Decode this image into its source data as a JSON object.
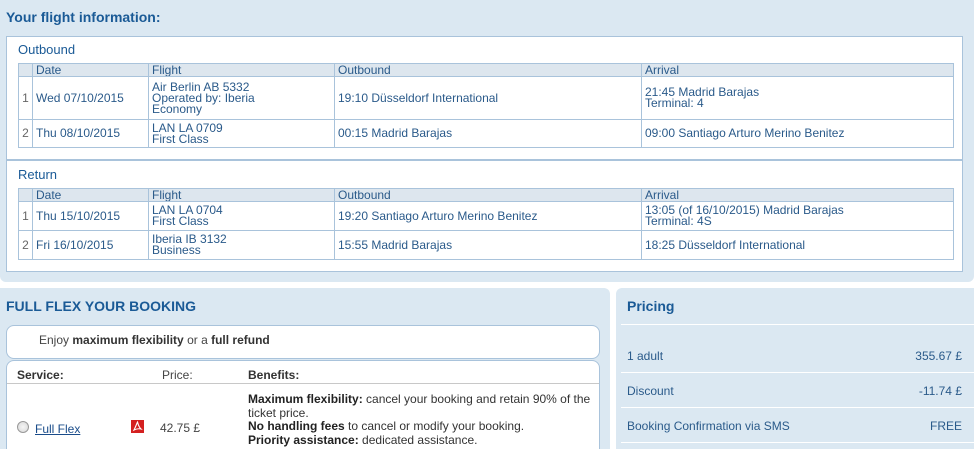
{
  "flight_info": {
    "title": "Your flight information:",
    "columns": [
      "Date",
      "Flight",
      "Outbound",
      "Arrival"
    ],
    "outbound": {
      "title": "Outbound",
      "rows": [
        {
          "n": "1",
          "date": "Wed 07/10/2015",
          "flight": [
            "Air Berlin AB 5332",
            "Operated by: Iberia",
            "Economy"
          ],
          "dep": "19:10 Düsseldorf International",
          "arr": [
            "21:45 Madrid Barajas",
            "Terminal: 4"
          ]
        },
        {
          "n": "2",
          "date": "Thu 08/10/2015",
          "flight": [
            "LAN LA 0709",
            "First Class"
          ],
          "dep": "00:15 Madrid Barajas",
          "arr": [
            "09:00 Santiago Arturo Merino Benitez"
          ]
        }
      ]
    },
    "return": {
      "title": "Return",
      "rows": [
        {
          "n": "1",
          "date": "Thu 15/10/2015",
          "flight": [
            "LAN LA 0704",
            "First Class"
          ],
          "dep": "19:20 Santiago Arturo Merino Benitez",
          "arr": [
            "13:05 (of 16/10/2015) Madrid Barajas",
            "Terminal: 4S"
          ]
        },
        {
          "n": "2",
          "date": "Fri 16/10/2015",
          "flight": [
            "Iberia IB 3132",
            "Business"
          ],
          "dep": "15:55 Madrid Barajas",
          "arr": [
            "18:25 Düsseldorf International"
          ]
        }
      ]
    }
  },
  "full_flex": {
    "title": "FULL FLEX YOUR BOOKING",
    "enjoy": {
      "a": "Enjoy ",
      "b": "maximum flexibility",
      "c": " or a ",
      "d": "full refund"
    },
    "headers": {
      "service": "Service:",
      "price": "Price:",
      "benefits": "Benefits:"
    },
    "service_name": "Full Flex",
    "icon": "pdf-icon",
    "price": "42.75 £",
    "benefits": [
      {
        "b": "Maximum flexibility:",
        "t": " cancel your booking and retain 90% of the ticket price."
      },
      {
        "b": "No handling fees",
        "t": " to cancel or modify your booking."
      },
      {
        "b": "Priority assistance:",
        "t": " dedicated assistance."
      }
    ]
  },
  "pricing": {
    "title": "Pricing",
    "rows": [
      {
        "label": "1 adult",
        "value": "355.67 £"
      },
      {
        "label": "Discount",
        "value": "-11.74 £"
      },
      {
        "label": "Booking Confirmation via SMS",
        "value": "FREE"
      }
    ]
  },
  "colors": {
    "panel": "#dbe8f2",
    "border": "#a9c3db",
    "text": "#2a5a8a",
    "header_bg": "#dde6ee"
  }
}
